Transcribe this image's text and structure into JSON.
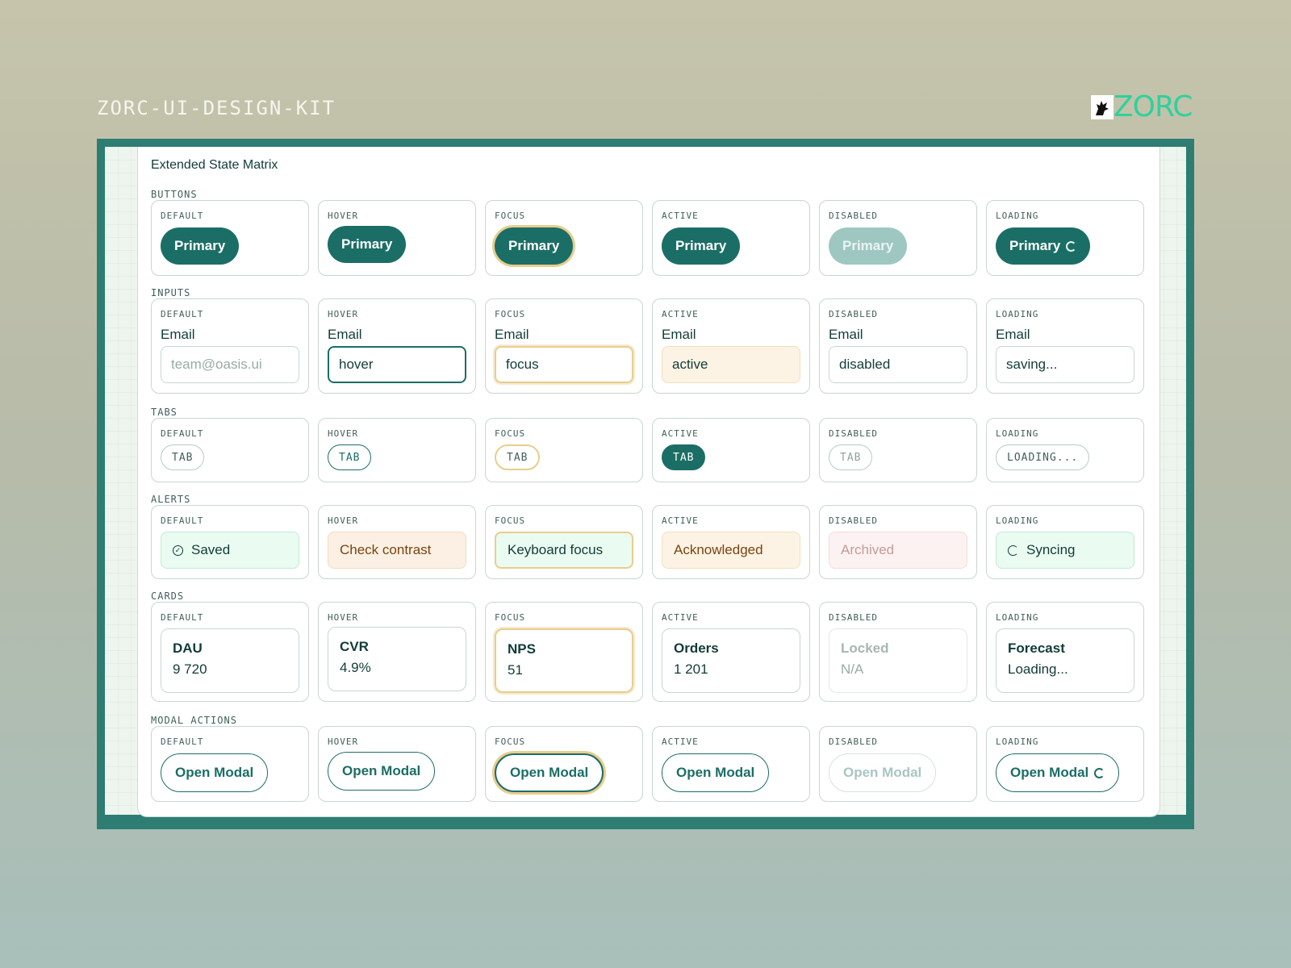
{
  "kit_title": "ZORC-UI-DESIGN-KIT",
  "brand": {
    "name": "ZORC",
    "icon": "wolf-logo-icon",
    "color": "#2fd19c"
  },
  "panel_title": "Extended State Matrix",
  "states": [
    "DEFAULT",
    "HOVER",
    "FOCUS",
    "ACTIVE",
    "DISABLED",
    "LOADING"
  ],
  "sections": {
    "buttons": "BUTTONS",
    "inputs": "INPUTS",
    "tabs": "TABS",
    "alerts": "ALERTS",
    "cards": "CARDS",
    "modal": "MODAL ACTIONS"
  },
  "buttons": {
    "label": "Primary"
  },
  "inputs": {
    "label": "Email",
    "default_placeholder": "team@oasis.ui",
    "hover": "hover",
    "focus": "focus",
    "active": "active",
    "disabled": "disabled",
    "loading": "saving..."
  },
  "tabs": {
    "label": "TAB",
    "loading": "LOADING..."
  },
  "alerts": {
    "default": "Saved",
    "hover": "Check contrast",
    "focus": "Keyboard focus",
    "active": "Acknowledged",
    "disabled": "Archived",
    "loading": "Syncing"
  },
  "cards": {
    "default": {
      "title": "DAU",
      "value": "9 720"
    },
    "hover": {
      "title": "CVR",
      "value": "4.9%"
    },
    "focus": {
      "title": "NPS",
      "value": "51"
    },
    "active": {
      "title": "Orders",
      "value": "1 201"
    },
    "disabled": {
      "title": "Locked",
      "value": "N/A"
    },
    "loading": {
      "title": "Forecast",
      "value": "Loading..."
    }
  },
  "modal": {
    "label": "Open Modal"
  },
  "colors": {
    "primary": "#1b6e66",
    "focus_ring": "#e9cd8d",
    "frame": "#2d7d73"
  }
}
